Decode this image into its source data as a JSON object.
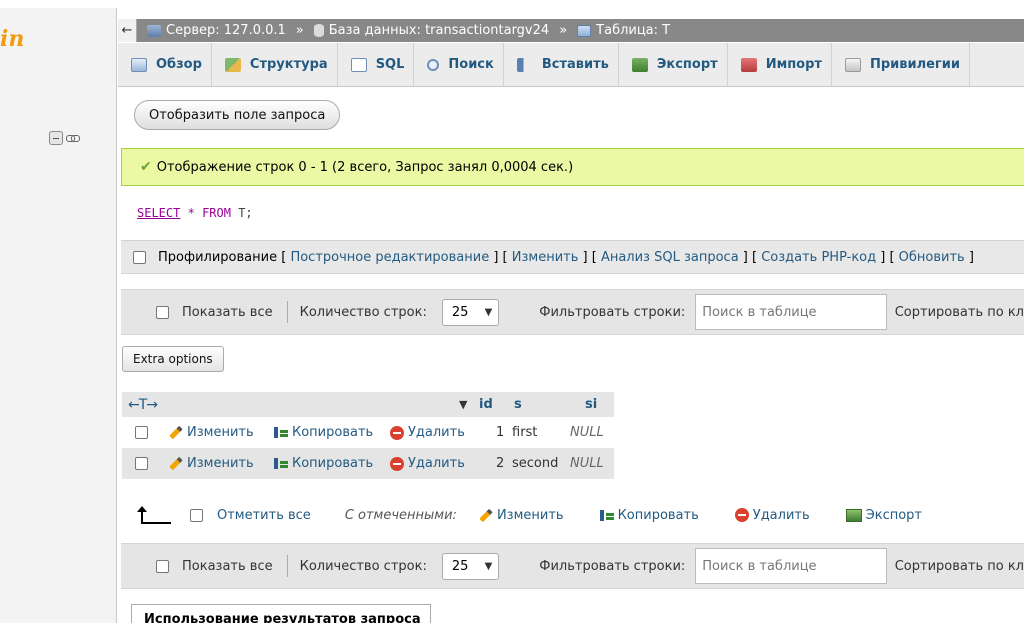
{
  "app": {
    "logo_text": "in"
  },
  "breadcrumb": {
    "back": "←",
    "server": "Сервер: 127.0.0.1",
    "database": "База данных: transactiontargv24",
    "table": "Таблица: T",
    "separator": "»"
  },
  "tabs": [
    {
      "label": "Обзор",
      "icon": "browse-icon"
    },
    {
      "label": "Структура",
      "icon": "structure-icon"
    },
    {
      "label": "SQL",
      "icon": "sql-icon"
    },
    {
      "label": "Поиск",
      "icon": "search-icon"
    },
    {
      "label": "Вставить",
      "icon": "insert-icon"
    },
    {
      "label": "Экспорт",
      "icon": "export-icon"
    },
    {
      "label": "Импорт",
      "icon": "import-icon"
    },
    {
      "label": "Привилегии",
      "icon": "privileges-icon"
    }
  ],
  "query_box_button": "Отобразить поле запроса",
  "success_message": "Отображение строк 0 - 1 (2 всего, Запрос занял 0,0004 сек.)",
  "sql": {
    "select": "SELECT",
    "star": "*",
    "from": "FROM",
    "table": "T;"
  },
  "profiling": {
    "label": "Профилирование",
    "links": [
      "Построчное редактирование",
      "Изменить",
      "Анализ SQL запроса",
      "Создать PHP-код",
      "Обновить"
    ]
  },
  "navbar": {
    "show_all": "Показать все",
    "rows_label": "Количество строк:",
    "rows_value": "25",
    "filter_label": "Фильтровать строки:",
    "filter_placeholder": "Поиск в таблице",
    "sort_label": "Сортировать по кл"
  },
  "extra_options": "Extra options",
  "table": {
    "arrows": "←T→",
    "columns": [
      "id",
      "s",
      "si"
    ],
    "actions": {
      "edit": "Изменить",
      "copy": "Копировать",
      "delete": "Удалить"
    },
    "rows": [
      {
        "id": "1",
        "s": "first",
        "si": "NULL"
      },
      {
        "id": "2",
        "s": "second",
        "si": "NULL"
      }
    ]
  },
  "bulk": {
    "check_all": "Отметить все",
    "with_selected": "С отмеченными:",
    "edit": "Изменить",
    "copy": "Копировать",
    "delete": "Удалить",
    "export": "Экспорт"
  },
  "query_results_title": "Использование результатов запроса"
}
